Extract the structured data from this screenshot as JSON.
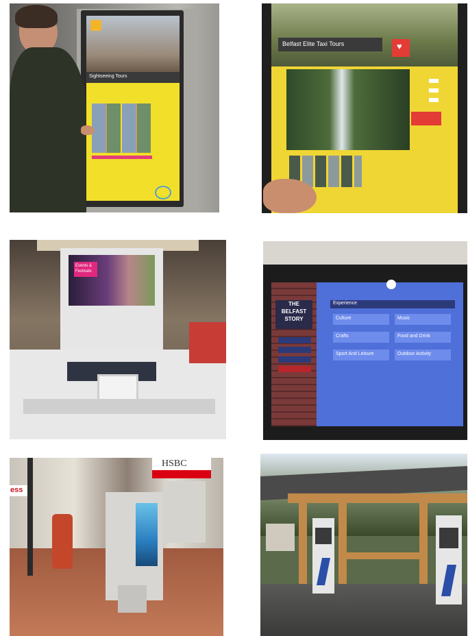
{
  "photo_grid": {
    "photos": [
      {
        "scene": "kiosk-user-touch",
        "screen": {
          "heading": "Sightseeing Tours"
        },
        "colors": {
          "panel": "#f2df2a",
          "frame": "#2a2a2a",
          "wall": "#8d8d8d"
        }
      },
      {
        "scene": "kiosk-tour-detail",
        "screen": {
          "heading": "Belfast Elite Taxi Tours"
        },
        "colors": {
          "panel": "#f0d634",
          "badge": "#e33b36",
          "frame": "#1f1f1f"
        }
      },
      {
        "scene": "mall-kiosk-stand",
        "screen": {
          "heading": "Events & Festivals"
        },
        "colors": {
          "magenta": "#e0287d",
          "stand": "#e8e8e8",
          "mall": "#6b5d4f"
        }
      },
      {
        "scene": "belfast-story-screen",
        "screen": {
          "title_line1": "THE",
          "title_line2": "BELFAST",
          "title_line3": "STORY",
          "banner": "Experience",
          "grid": [
            "Culture",
            "Music",
            "Crafts",
            "Food and Drink",
            "Sport And Leisure",
            "Outdoor Activity"
          ]
        },
        "colors": {
          "screen": "#4f6fd9",
          "cell": "#6e8cec",
          "brick": "#7a3a3a",
          "selected": "#b8252b"
        }
      },
      {
        "scene": "street-kiosk",
        "signs": {
          "bank": "HSBC",
          "shop": "ess"
        },
        "colors": {
          "pavement": "#b36a4a",
          "kiosk": "#d8d6d2",
          "bank_red": "#db0011"
        }
      },
      {
        "scene": "wooden-shelter-kiosks",
        "colors": {
          "roof": "#4b4a4a",
          "wood": "#c28a4a",
          "kiosk": "#e6e6e6",
          "info_blue": "#2b4fa8"
        }
      }
    ]
  }
}
